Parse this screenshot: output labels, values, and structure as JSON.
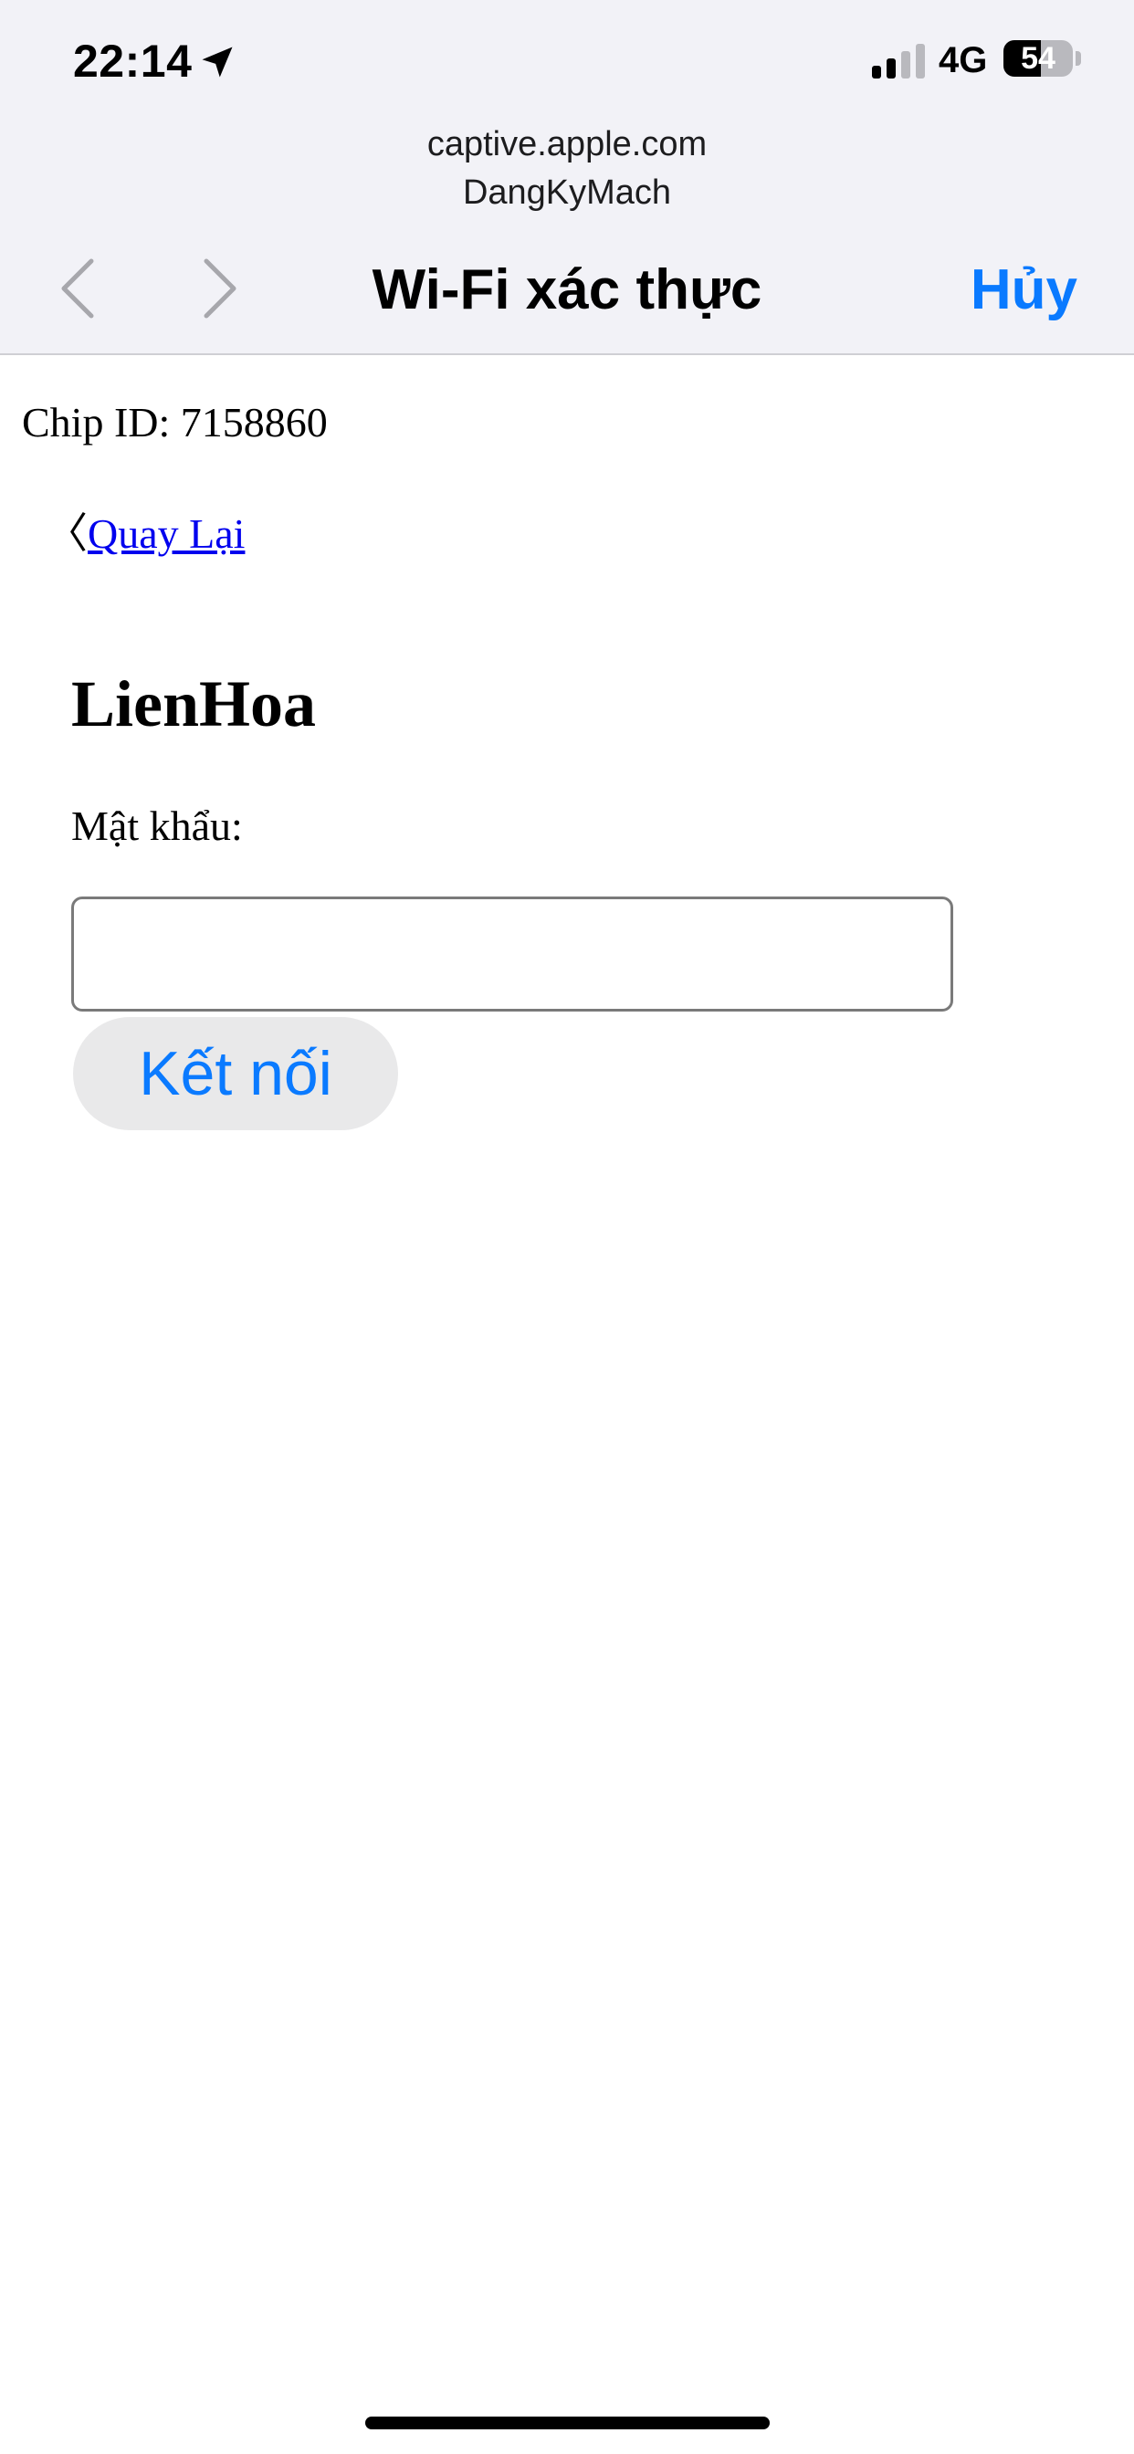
{
  "status_bar": {
    "time": "22:14",
    "location_icon": "location-arrow-icon",
    "network": "4G",
    "battery_level": "54",
    "battery_percent": 54
  },
  "captive_header": {
    "url": "captive.apple.com",
    "site_name": "DangKyMach",
    "title": "Wi-Fi xác thực",
    "cancel_label": "Hủy",
    "back_icon": "chevron-left-icon",
    "forward_icon": "chevron-right-icon",
    "accent_color": "#0a7aff"
  },
  "page": {
    "chip_id": "Chip ID: 7158860",
    "back_chevron": "〈",
    "back_link": "Quay Lại",
    "network_name": "LienHoa",
    "password_label": "Mật khẩu:",
    "password_value": "",
    "connect_button": "Kết nối"
  }
}
